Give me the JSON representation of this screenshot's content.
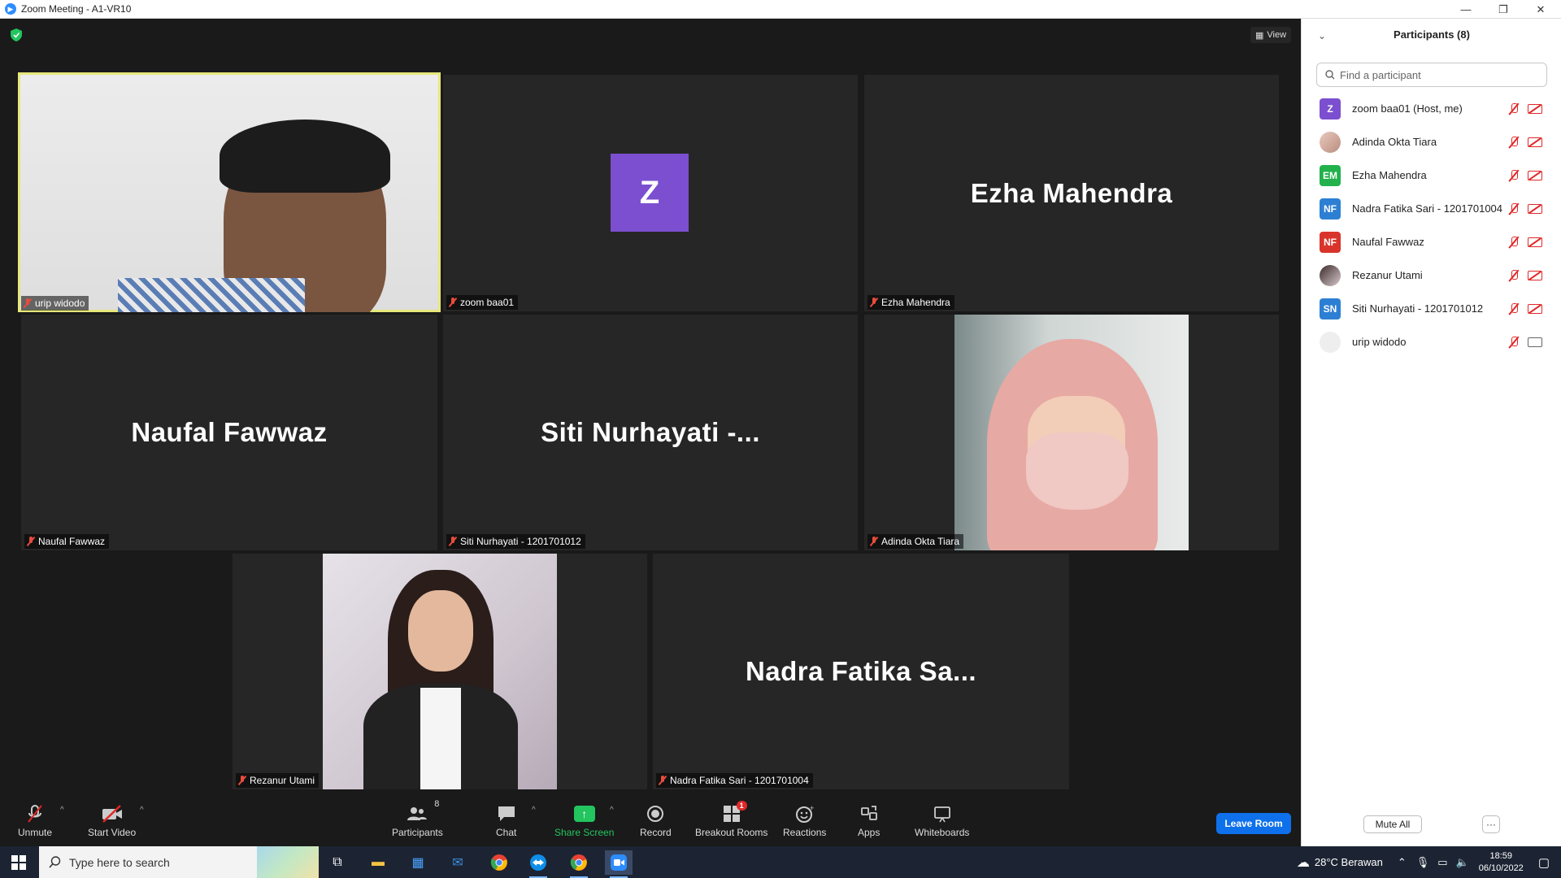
{
  "window": {
    "title": "Zoom Meeting - A1-VR10",
    "minimize": "—",
    "restore": "❐",
    "close": "✕"
  },
  "meeting": {
    "view_label": "View",
    "tiles": [
      {
        "name": "urip widodo",
        "display": "",
        "muted": true,
        "active": true
      },
      {
        "name": "zoom baa01",
        "display": "Z",
        "muted": true
      },
      {
        "name": "Ezha Mahendra",
        "display": "Ezha Mahendra",
        "muted": true
      },
      {
        "name": "Naufal Fawwaz",
        "display": "Naufal Fawwaz",
        "muted": true
      },
      {
        "name": "Siti Nurhayati - 1201701012",
        "display": "Siti Nurhayati -...",
        "muted": true
      },
      {
        "name": "Adinda Okta Tiara",
        "display": "",
        "muted": true
      },
      {
        "name": "Rezanur Utami",
        "display": "",
        "muted": true
      },
      {
        "name": "Nadra Fatika Sari - 1201701004",
        "display": "Nadra Fatika Sa...",
        "muted": true
      }
    ]
  },
  "toolbar": {
    "unmute": "Unmute",
    "start_video": "Start Video",
    "participants": "Participants",
    "participants_count": "8",
    "chat": "Chat",
    "share_screen": "Share Screen",
    "record": "Record",
    "breakout_rooms": "Breakout Rooms",
    "breakout_badge": "1",
    "reactions": "Reactions",
    "apps": "Apps",
    "whiteboards": "Whiteboards",
    "leave_room": "Leave Room"
  },
  "panel": {
    "title": "Participants (8)",
    "search_placeholder": "Find a participant",
    "participants": [
      {
        "initials": "Z",
        "name": "zoom baa01 (Host, me)",
        "color": "#7b4fd0",
        "video": "off"
      },
      {
        "initials": "",
        "name": "Adinda Okta Tiara",
        "color": "#d9b3a8",
        "video": "off"
      },
      {
        "initials": "EM",
        "name": "Ezha Mahendra",
        "color": "#22b14c",
        "video": "off"
      },
      {
        "initials": "NF",
        "name": "Nadra Fatika Sari - 1201701004",
        "color": "#2d7fd3",
        "video": "off"
      },
      {
        "initials": "NF",
        "name": "Naufal Fawwaz",
        "color": "#d9342b",
        "video": "off"
      },
      {
        "initials": "",
        "name": "Rezanur Utami",
        "color": "#c9bfc4",
        "video": "off"
      },
      {
        "initials": "SN",
        "name": "Siti Nurhayati - 1201701012",
        "color": "#2d7fd3",
        "video": "off"
      },
      {
        "initials": "",
        "name": "urip widodo",
        "color": "#eeeeee",
        "video": "on"
      }
    ],
    "mute_all": "Mute All",
    "more": "···"
  },
  "taskbar": {
    "search_text": "Type here to search",
    "weather": "28°C  Berawan",
    "time": "18:59",
    "date": "06/10/2022"
  }
}
